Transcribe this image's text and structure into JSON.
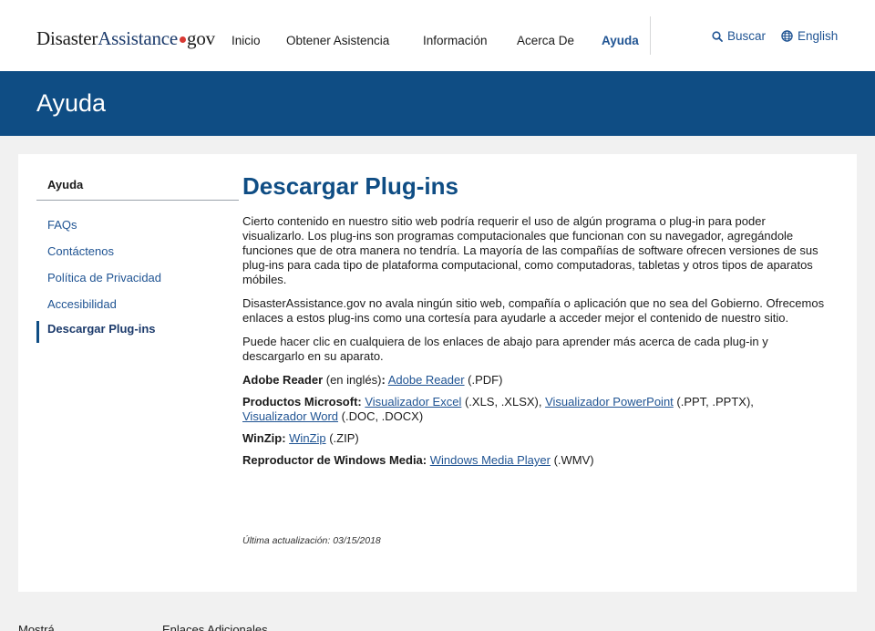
{
  "header": {
    "logo": {
      "part1": "Disaster",
      "part2": "Assistance",
      "part3": "gov"
    },
    "nav": [
      {
        "label": "Inicio"
      },
      {
        "label": "Obtener Asistencia"
      },
      {
        "label": "Información"
      },
      {
        "label": "Acerca De"
      },
      {
        "label": "Ayuda",
        "active": true
      }
    ],
    "search_label": "Buscar",
    "language_label": "English"
  },
  "banner": {
    "title": "Ayuda"
  },
  "sidebar": {
    "title": "Ayuda",
    "items": [
      {
        "label": "FAQs"
      },
      {
        "label": "Contáctenos"
      },
      {
        "label": "Política de Privacidad"
      },
      {
        "label": "Accesibilidad"
      },
      {
        "label": "Descargar Plug-ins",
        "current": true
      }
    ]
  },
  "content": {
    "title": "Descargar Plug-ins",
    "paragraphs": [
      "Cierto contenido en nuestro sitio web podría requerir el uso de algún programa o plug-in para poder visualizarlo. Los plug-ins son programas computacionales que funcionan con su navegador, agregándole funciones que de otra manera no tendría. La mayoría de las compañías de software ofrecen versiones de sus plug-ins para cada tipo de plataforma computacional, como computadoras, tabletas y otros tipos de aparatos móbiles.",
      "DisasterAssistance.gov no avala ningún sitio web, compañía o aplicación que no sea del Gobierno. Ofrecemos enlaces a estos plug-ins como una cortesía para ayudarle a acceder mejor el contenido de nuestro sitio.",
      "Puede hacer clic en cualquiera de los enlaces de abajo para aprender más acerca de cada plug-in y descargarlo en su aparato."
    ],
    "adobe": {
      "label": "Adobe Reader",
      "note": " (en inglés)",
      "colon": ":",
      "link": "Adobe Reader",
      "ext": " (.PDF)"
    },
    "microsoft": {
      "label": "Productos Microsoft:",
      "link_excel": "Visualizador Excel",
      "ext_excel": " (.XLS, .XLSX), ",
      "link_ppt": "Visualizador PowerPoint",
      "ext_ppt": " (.PPT, .PPTX),",
      "link_word": "Visualizador Word",
      "ext_word": " (.DOC, .DOCX)"
    },
    "winzip": {
      "label": "WinZip:",
      "link": "WinZip",
      "ext": " (.ZIP)"
    },
    "wmp": {
      "label": "Reproductor de Windows Media:",
      "link": "Windows Media Player",
      "ext": " (.WMV)"
    },
    "updated": "Última actualización: 03/15/2018"
  },
  "footer_peek": {
    "left": "Mostrá",
    "right": "Enlaces Adicionales"
  },
  "colors": {
    "brand_blue": "#0f4d84",
    "link_blue": "#205493",
    "logo_dot": "#d83933"
  }
}
